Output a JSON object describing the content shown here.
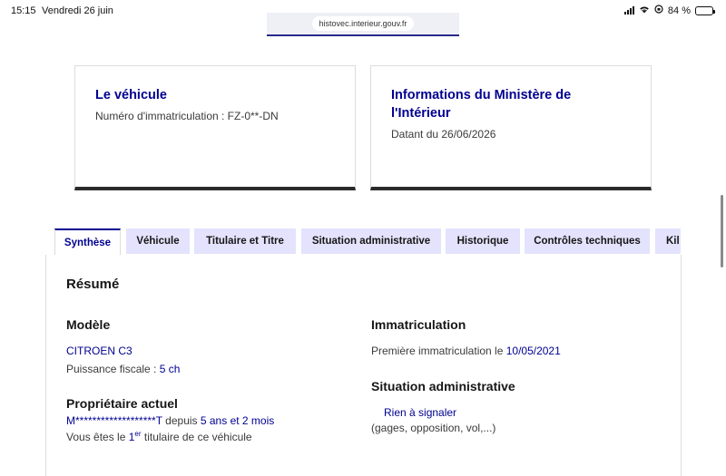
{
  "status_bar": {
    "time": "15:15",
    "date": "Vendredi 26 juin",
    "battery": "84 %",
    "battery_level": 0.84
  },
  "browser": {
    "url": "histovec.interieur.gouv.fr"
  },
  "cards": {
    "vehicle": {
      "title": "Le véhicule",
      "text": "Numéro d'immatriculation : FZ-0**-DN"
    },
    "ministry": {
      "title_line1": "Informations du Ministère de",
      "title_line2": "l'Intérieur",
      "text": "Datant du 26/06/2026"
    }
  },
  "tabs": [
    {
      "label": "Synthèse"
    },
    {
      "label": "Véhicule"
    },
    {
      "label": "Titulaire et Titre"
    },
    {
      "label": "Situation administrative"
    },
    {
      "label": "Historique"
    },
    {
      "label": "Contrôles techniques"
    },
    {
      "label": "Kil"
    }
  ],
  "summary": {
    "heading": "Résumé",
    "model": {
      "heading": "Modèle",
      "name": "CITROEN C3",
      "power_label": "Puissance fiscale : ",
      "power_value": "5 ch"
    },
    "owner": {
      "heading": "Propriétaire actuel",
      "name": "M*******************T",
      "since_label": " depuis ",
      "since_value": "5 ans et 2 mois",
      "rank_prefix": "Vous êtes le ",
      "rank_number": "1",
      "rank_sup": "er",
      "rank_suffix": " titulaire de ce véhicule"
    },
    "registration": {
      "heading": "Immatriculation",
      "first_label": "Première immatriculation le ",
      "first_date": "10/05/2021"
    },
    "admin": {
      "heading": "Situation administrative",
      "status": "Rien à signaler",
      "detail": "(gages, opposition, vol,...)"
    }
  },
  "colors": {
    "accent": "#000091",
    "tab_bg": "#e3e3fd"
  }
}
